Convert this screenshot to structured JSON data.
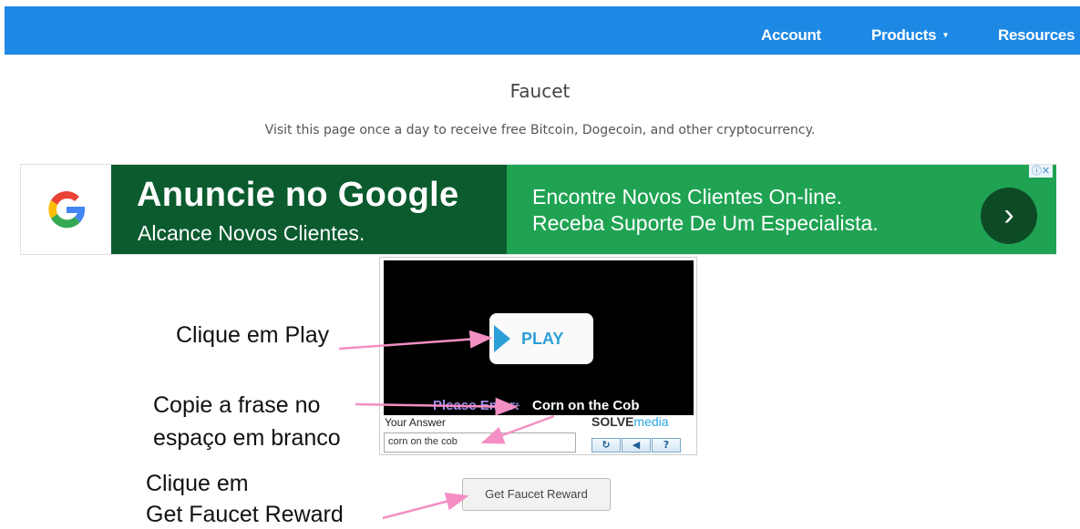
{
  "navbar": {
    "items": [
      {
        "label": "Account"
      },
      {
        "label": "Products"
      },
      {
        "label": "Resources"
      }
    ],
    "caret": "▾"
  },
  "page": {
    "title": "Faucet",
    "subtitle": "Visit this page once a day to receive free Bitcoin, Dogecoin, and other cryptocurrency."
  },
  "ad": {
    "logo_letter": "G",
    "headline": "Anuncie no Google",
    "subline": "Alcance Novos Clientes.",
    "line1": "Encontre Novos Clientes On-line.",
    "line2": "Receba Suporte De Um Especialista.",
    "arrow": "›",
    "choices": "ⓘ✕",
    "colors": {
      "dark": "#0b5b2e",
      "green": "#1fa353"
    }
  },
  "captcha": {
    "play_label": "PLAY",
    "please_enter": "Please Enter:",
    "phrase": "Corn on the Cob",
    "answer_label": "Your Answer",
    "answer_value": "corn on the cob",
    "brand_a": "SOLVE",
    "brand_b": "media",
    "controls": [
      {
        "icon": "refresh-icon",
        "glyph": "↻"
      },
      {
        "icon": "audio-icon",
        "glyph": "◀"
      },
      {
        "icon": "help-icon",
        "glyph": "?"
      }
    ]
  },
  "reward_button": "Get Faucet Reward",
  "annotations": {
    "play": "Clique em Play",
    "copy_line1": "Copie a frase no",
    "copy_line2": "espaço em branco",
    "reward_line1": "Clique em",
    "reward_line2": "Get Faucet Reward"
  },
  "colors": {
    "navbar": "#1e88e5",
    "annotation_arrow": "#f48fc4"
  }
}
